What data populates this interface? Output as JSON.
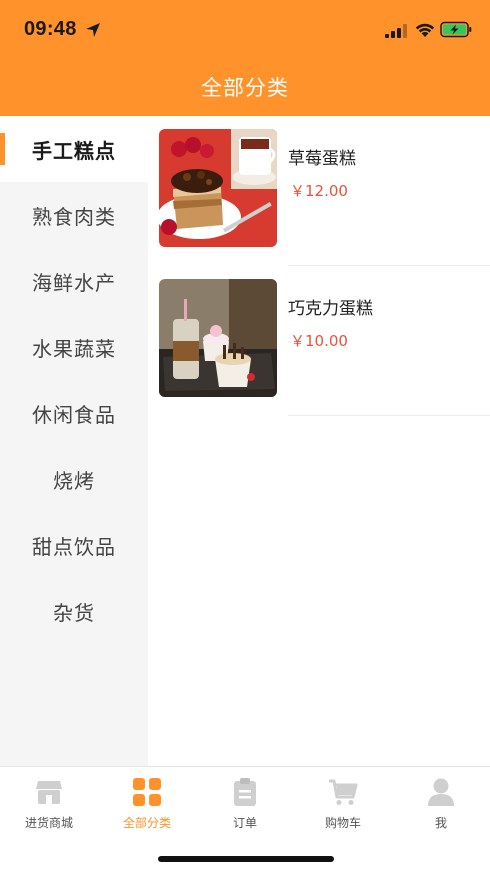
{
  "status_bar": {
    "time": "09:48"
  },
  "header": {
    "title": "全部分类"
  },
  "sidebar": {
    "items": [
      {
        "label": "手工糕点",
        "active": true
      },
      {
        "label": "熟食肉类"
      },
      {
        "label": "海鲜水产"
      },
      {
        "label": "水果蔬菜"
      },
      {
        "label": "休闲食品"
      },
      {
        "label": "烧烤"
      },
      {
        "label": "甜点饮品"
      },
      {
        "label": "杂货"
      }
    ]
  },
  "products": [
    {
      "name": "草莓蛋糕",
      "price": "￥12.00",
      "image_icon": "strawberry-cake-photo"
    },
    {
      "name": "巧克力蛋糕",
      "price": "￥10.00",
      "image_icon": "chocolate-cake-photo"
    }
  ],
  "tabbar": {
    "items": [
      {
        "label": "进货商城",
        "icon": "store-icon"
      },
      {
        "label": "全部分类",
        "icon": "grid-icon",
        "active": true
      },
      {
        "label": "订单",
        "icon": "clipboard-icon"
      },
      {
        "label": "购物车",
        "icon": "cart-icon"
      },
      {
        "label": "我",
        "icon": "user-icon"
      }
    ]
  },
  "colors": {
    "accent": "#FF922B",
    "price": "#E8533A",
    "inactive_icon": "#cfcfcf",
    "sidebar_bg": "#f5f5f5"
  }
}
